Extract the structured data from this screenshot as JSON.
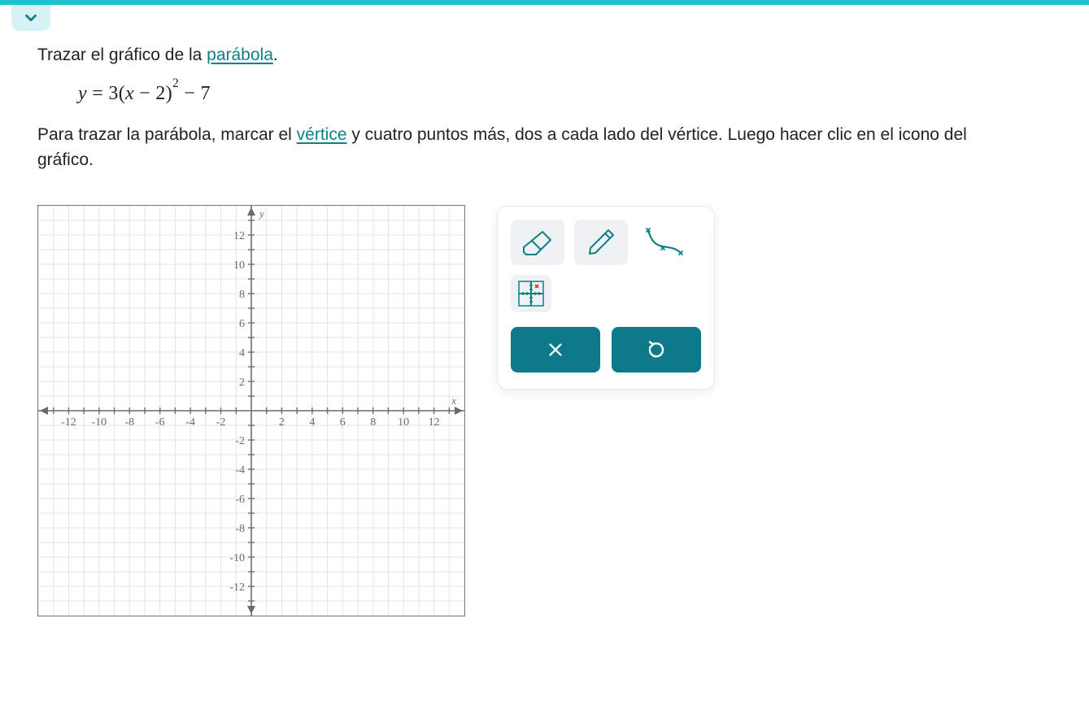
{
  "prompt": {
    "pre": "Trazar el gráfico de la ",
    "link": "parábola",
    "post": "."
  },
  "equation": {
    "y": "y",
    "eq": " = ",
    "a": "3",
    "open": "(",
    "x": "x",
    "minus": " − ",
    "h": "2",
    "close": ")",
    "exp": "2",
    "tail": " − 7"
  },
  "instructions": {
    "pre": "Para trazar la parábola, marcar el ",
    "link": "vértice",
    "post": " y cuatro puntos más, dos a cada lado del vértice. Luego hacer clic en el icono del gráfico."
  },
  "chart_data": {
    "type": "scatter",
    "title": "",
    "xlabel": "x",
    "ylabel": "y",
    "xlim": [
      -14,
      14
    ],
    "ylim": [
      -14,
      14
    ],
    "x_ticks": [
      -12,
      -10,
      -8,
      -6,
      -4,
      -2,
      2,
      4,
      6,
      8,
      10,
      12
    ],
    "y_ticks": [
      12,
      10,
      8,
      6,
      4,
      2,
      -2,
      -4,
      -6,
      -8,
      -10,
      -12
    ],
    "series": []
  },
  "tools": {
    "eraser": "eraser",
    "pencil": "pencil",
    "curve": "curve",
    "grid": "plot-points",
    "clear": "clear",
    "undo": "undo"
  }
}
